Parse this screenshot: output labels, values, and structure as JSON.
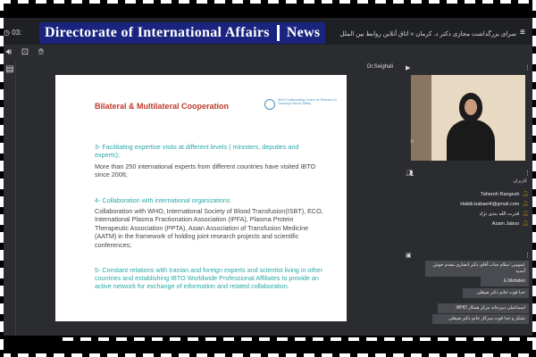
{
  "banner": {
    "left_text": "Directorate of International Affairs",
    "right_text": "News"
  },
  "topbar": {
    "time": "03:",
    "meeting_title": "سرای بزرگداشت مجازی دکتر د. کرمان » اتاق آنلاین روابط بین الملل"
  },
  "presenter": {
    "name": "Dr.Seighali"
  },
  "slide": {
    "title": "Bilateral & Multilateral Cooperation",
    "logo_text": "WHO Collaborating Centre for Research & Training in Blood Safety",
    "sec3_head": "3- Facilitating expertise visits at different levels ( ministers, deputies and experts);",
    "sec3_body": "More than 250 international experts from different countries have visited IBTO since 2006;",
    "sec4_head": "4- Collaboration with international organizations",
    "sec4_body": "Collaboration with WHO, International Society of Blood Transfusion(ISBT), ECO, International Plasma Fractionation Association (IPFA), Plasma Protein Therapeutic Association (PPTA), Asian Association of Transfusion Medicine (AATM) in the framework of holding joint research projects and scientific conferences;",
    "sec5_head": "5- Constant relations with Iranian and foreign experts and scientist living in other countries and establishing IBTO Worldwide Professional Affiliates to provide an active network for exchange of information and related collaboration."
  },
  "users": {
    "title": "کاربران",
    "items": [
      "Tahereh Rangesh",
      "Habib.babaei4@gmail.com",
      "قدرت الله بندی نژاد",
      "Azam Jaboo"
    ]
  },
  "chat": {
    "messages": [
      "عمومی: سلام جناب آقای دکتر انصاری مقدم خوش آمدید",
      "E.Mohideri",
      "خدا قوت خانم دکتر صیقلی",
      "اسماعیلی دبیرخانه مرکز همکار WHO",
      "تشکر و خدا قوت سرکار خانم دکتر صیقلی"
    ]
  }
}
